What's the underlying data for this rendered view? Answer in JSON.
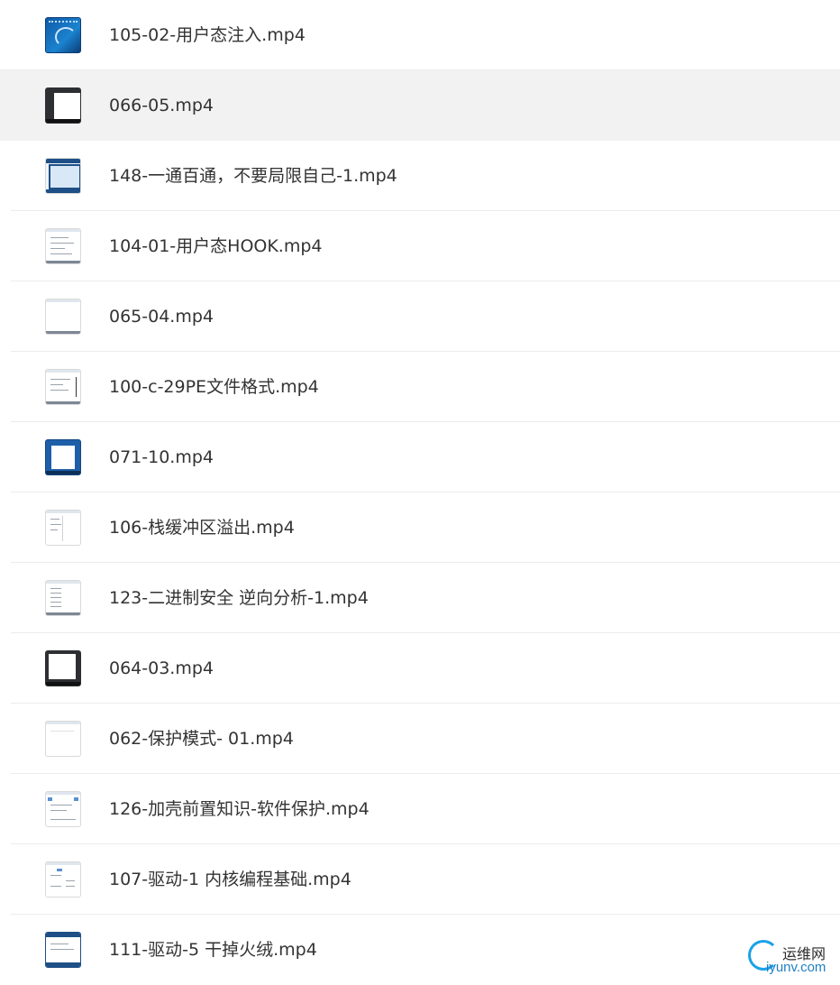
{
  "files": [
    {
      "name": "105-02-用户态注入.mp4",
      "thumb": "blue-desktop-icon"
    },
    {
      "name": "066-05.mp4",
      "thumb": "dark-window-icon"
    },
    {
      "name": "148-一通百通，不要局限自己-1.mp4",
      "thumb": "screen-frame-icon"
    },
    {
      "name": "104-01-用户态HOOK.mp4",
      "thumb": "document-icon"
    },
    {
      "name": "065-04.mp4",
      "thumb": "blank-document-icon"
    },
    {
      "name": "100-c-29PE文件格式.mp4",
      "thumb": "document-icon"
    },
    {
      "name": "071-10.mp4",
      "thumb": "blue-window-icon"
    },
    {
      "name": "106-栈缓冲区溢出.mp4",
      "thumb": "document-icon"
    },
    {
      "name": "123-二进制安全 逆向分析-1.mp4",
      "thumb": "document-icon"
    },
    {
      "name": "064-03.mp4",
      "thumb": "dark-window-icon"
    },
    {
      "name": "062-保护模式- 01.mp4",
      "thumb": "blank-document-icon"
    },
    {
      "name": "126-加壳前置知识-软件保护.mp4",
      "thumb": "document-icon"
    },
    {
      "name": "107-驱动-1 内核编程基础.mp4",
      "thumb": "document-icon"
    },
    {
      "name": "111-驱动-5 干掉火绒.mp4",
      "thumb": "document-icon"
    }
  ],
  "selected_index": 1,
  "watermark": {
    "cn": "运维网",
    "en": "iyunv.com"
  }
}
